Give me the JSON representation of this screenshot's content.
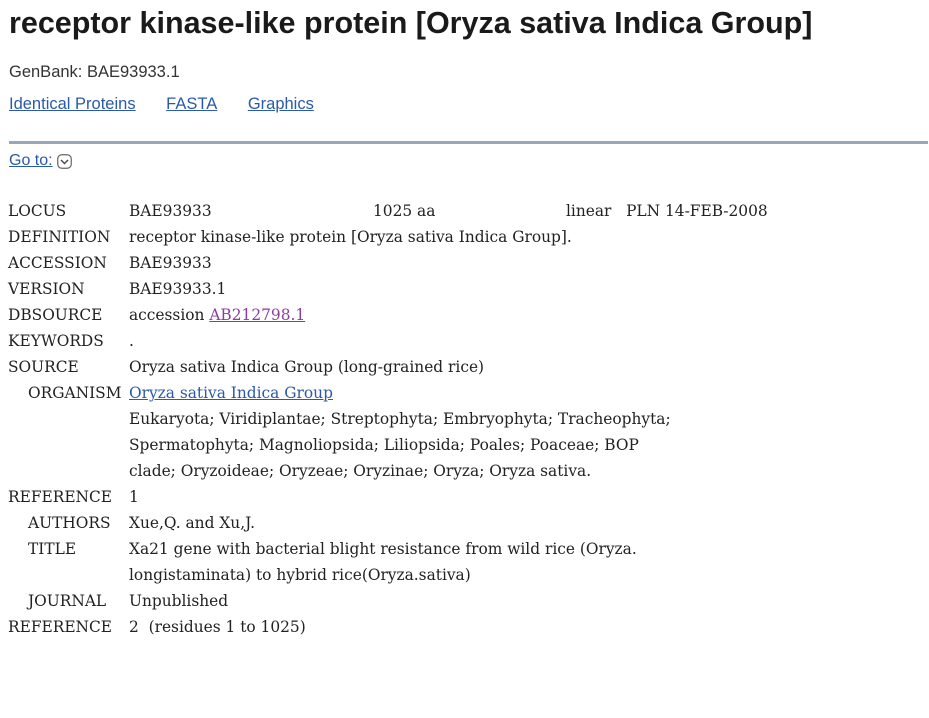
{
  "header": {
    "title": "receptor kinase-like protein [Oryza sativa Indica Group]",
    "subtitle": "GenBank: BAE93933.1",
    "links": [
      "Identical Proteins",
      "FASTA",
      "Graphics"
    ]
  },
  "goto": {
    "label": "Go to:",
    "icon": "chevron-down-icon"
  },
  "record": {
    "locus": {
      "key": "LOCUS",
      "name": "BAE93933",
      "length": "1025 aa",
      "rest": "linear   PLN 14-FEB-2008"
    },
    "definition": {
      "key": "DEFINITION",
      "value": "receptor kinase-like protein [Oryza sativa Indica Group]."
    },
    "accession": {
      "key": "ACCESSION",
      "value": "BAE93933"
    },
    "version": {
      "key": "VERSION",
      "value": "BAE93933.1"
    },
    "dbsource": {
      "key": "DBSOURCE",
      "prefix": "accession ",
      "link": "AB212798.1"
    },
    "keywords": {
      "key": "KEYWORDS",
      "value": "."
    },
    "source": {
      "key": "SOURCE",
      "value": "Oryza sativa Indica Group (long-grained rice)"
    },
    "organism": {
      "key": "ORGANISM",
      "link": "Oryza sativa Indica Group",
      "lineage": [
        "Eukaryota; Viridiplantae; Streptophyta; Embryophyta; Tracheophyta;",
        "Spermatophyta; Magnoliopsida; Liliopsida; Poales; Poaceae; BOP",
        "clade; Oryzoideae; Oryzeae; Oryzinae; Oryza; Oryza sativa."
      ]
    },
    "reference1": {
      "key": "REFERENCE",
      "value": "1"
    },
    "authors": {
      "key": "AUTHORS",
      "value": "Xue,Q. and Xu,J."
    },
    "title": {
      "key": "TITLE",
      "lines": [
        "Xa21 gene with bacterial blight resistance from wild rice (Oryza.",
        "longistaminata) to hybrid rice(Oryza.sativa)"
      ]
    },
    "journal": {
      "key": "JOURNAL",
      "value": "Unpublished"
    },
    "reference2": {
      "key": "REFERENCE",
      "value": "2  (residues 1 to 1025)"
    }
  },
  "colors": {
    "link": "#2b5aa8",
    "visited_link": "#8b3aa6",
    "highlight": "#e8101c",
    "rule": "#98a6bd"
  }
}
